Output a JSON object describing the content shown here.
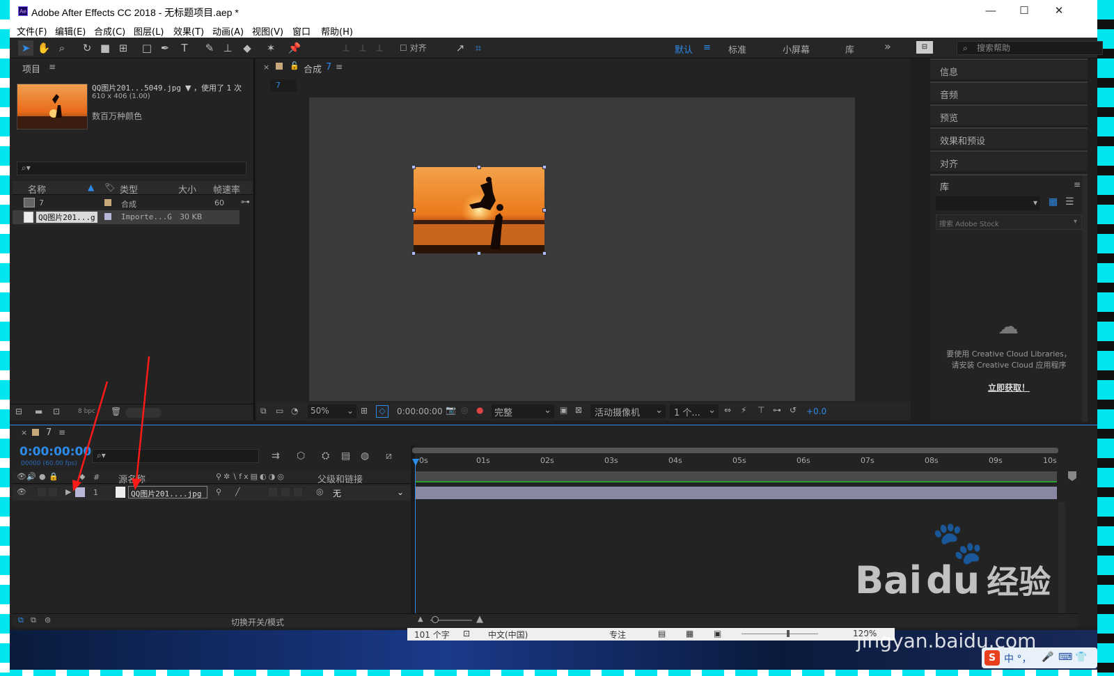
{
  "window": {
    "title": "Adobe After Effects CC 2018 - 无标题项目.aep *",
    "app_icon_text": "Ae",
    "minimize": "—",
    "maximize": "☐",
    "close": "✕"
  },
  "menu": [
    "文件(F)",
    "编辑(E)",
    "合成(C)",
    "图层(L)",
    "效果(T)",
    "动画(A)",
    "视图(V)",
    "窗口",
    "帮助(H)"
  ],
  "toolbar": {
    "align_label": "对齐",
    "workspaces": [
      "默认",
      "标准",
      "小屏幕",
      "库"
    ],
    "active_workspace": "默认",
    "more": "»",
    "search_placeholder": "搜索帮助"
  },
  "project": {
    "title": "项目",
    "menu_icon": "≡",
    "selected_name": "QQ图片201...5049.jpg",
    "used_text": "▼ ，使用了 1 次",
    "dimensions": "610 x 406 (1.00)",
    "colors": "数百万种颜色",
    "search_icon": "⌕▾",
    "columns": [
      "名称",
      "类型",
      "大小",
      "帧速率"
    ],
    "items": [
      {
        "name": "7",
        "type": "合成",
        "size": "",
        "fps": "60",
        "label_color": "#c9a77c"
      },
      {
        "name": "QQ图片201...g",
        "type": "Importe...G",
        "size": "30 KB",
        "fps": "",
        "label_color": "#b6b6d8"
      }
    ],
    "bpc": "8 bpc"
  },
  "composition": {
    "tab_title": "合成",
    "tab_name": "7",
    "breadcrumb": "7",
    "zoom": "50%",
    "timecode": "0:00:00:00",
    "resolution": "完整",
    "camera": "活动摄像机",
    "views": "1 个...",
    "exposure": "+0.0"
  },
  "right_panels": [
    "信息",
    "音频",
    "预览",
    "效果和预设",
    "对齐"
  ],
  "library": {
    "title": "库",
    "search_placeholder": "搜索 Adobe Stock",
    "message_line1": "要使用 Creative Cloud Libraries，",
    "message_line2": "请安装 Creative Cloud 应用程序",
    "cta": "立即获取！"
  },
  "timeline": {
    "tab_name": "7",
    "timecode": "0:00:00:00",
    "fps_info": "00000 (60.00 fps)",
    "search_icon": "⌕▾",
    "col_num": "#",
    "col_source": "源名称",
    "col_parent": "父级和链接",
    "layer": {
      "num": "1",
      "name": "QQ图片201....jpg",
      "parent": "无"
    },
    "ruler": [
      "0s",
      "01s",
      "02s",
      "03s",
      "04s",
      "05s",
      "06s",
      "07s",
      "08s",
      "09s",
      "10s"
    ],
    "toggle_label": "切换开关/模式"
  },
  "taskbar_overlay": {
    "word_count": "101 个字",
    "language": "中文(中国)",
    "focus": "专注",
    "zoom": "120%"
  },
  "watermark": {
    "brand": "Bai",
    "brand2": "du",
    "brand3": "经验",
    "url": "jingyan.baidu.com"
  },
  "ime": {
    "text": "中 °，"
  },
  "colors": {
    "accent": "#2d8ceb",
    "timecode": "#2d8ceb",
    "layer_bar": "#9a9ab8",
    "arrow": "#ff1a1a"
  }
}
